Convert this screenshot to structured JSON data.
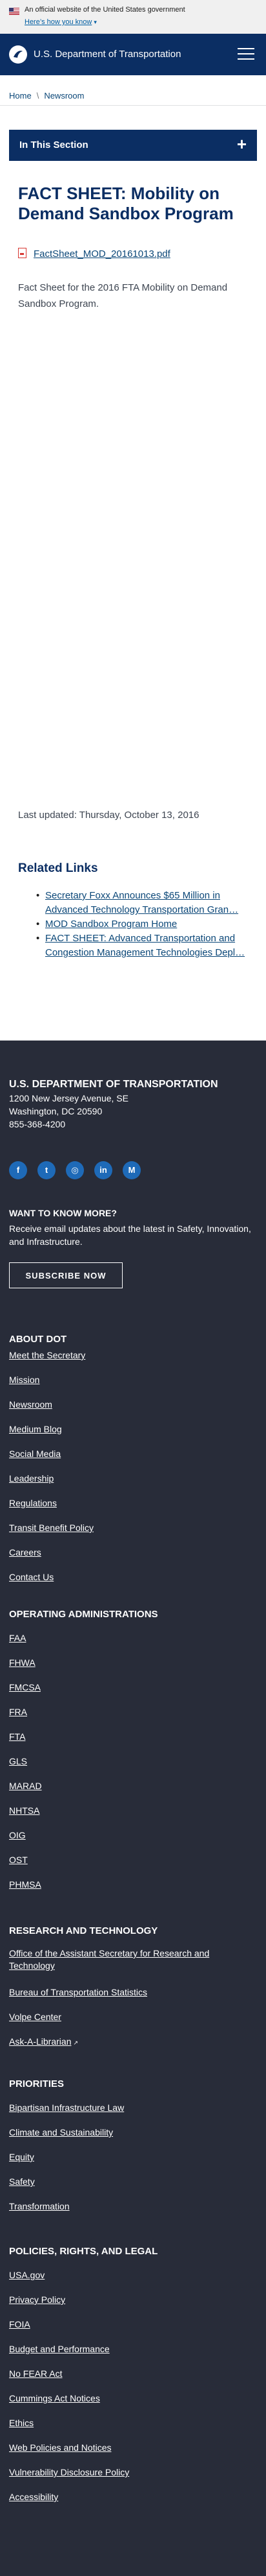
{
  "banner": {
    "official_text": "An official website of the United States government",
    "how_link": "Here’s how you know"
  },
  "header": {
    "title": "U.S. Department of Transportation",
    "menu_icon": "hamburger-menu-icon"
  },
  "breadcrumb": {
    "items": [
      "Home",
      "Newsroom"
    ],
    "separator": "\\"
  },
  "section_nav": {
    "label": "In This Section",
    "toggle": "+"
  },
  "main": {
    "title": "FACT SHEET: Mobility on Demand Sandbox Program",
    "attachment": {
      "icon": "pdf-icon",
      "label": "FactSheet_MOD_20161013.pdf"
    },
    "description": "Fact Sheet for the 2016 FTA Mobility on Demand Sandbox Program.",
    "last_updated": "Last updated: Thursday, October 13, 2016"
  },
  "related": {
    "title": "Related Links",
    "items": [
      "Secretary Foxx Announces $65 Million in Advanced Technology Transportation Gran…",
      "MOD Sandbox Program Home",
      "FACT SHEET: Advanced Transportation and Congestion Management Technologies Depl…"
    ]
  },
  "footer": {
    "agency": "U.S. DEPARTMENT OF TRANSPORTATION",
    "address": [
      "1200 New Jersey Avenue, SE",
      "Washington, DC 20590",
      "855-368-4200"
    ],
    "social": [
      {
        "icon": "facebook-icon",
        "glyph": "f"
      },
      {
        "icon": "twitter-icon",
        "glyph": "t"
      },
      {
        "icon": "instagram-icon",
        "glyph": "◎"
      },
      {
        "icon": "linkedin-icon",
        "glyph": "in"
      },
      {
        "icon": "medium-icon",
        "glyph": "M"
      }
    ],
    "want_to_know_title": "WANT TO KNOW MORE?",
    "want_to_know_desc": "Receive email updates about the latest in Safety, Innovation, and Infrastructure.",
    "subscribe_label": "SUBSCRIBE NOW",
    "sections": [
      {
        "title": "ABOUT DOT",
        "links": [
          "Meet the Secretary",
          "Mission",
          "Newsroom",
          "Medium Blog",
          "Social Media",
          "Leadership",
          "Regulations",
          "Transit Benefit Policy",
          "Careers",
          "Contact Us"
        ]
      },
      {
        "title": "OPERATING ADMINISTRATIONS",
        "links": [
          "FAA",
          "FHWA",
          "FMCSA",
          "FRA",
          "FTA",
          "GLS",
          "MARAD",
          "NHTSA",
          "OIG",
          "OST",
          "PHMSA"
        ]
      },
      {
        "title": "RESEARCH AND TECHNOLOGY",
        "links": [
          "Office of the Assistant Secretary for Research and Technology",
          "Bureau of Transportation Statistics",
          "Volpe Center",
          "Ask-A-Librarian"
        ]
      },
      {
        "title": "PRIORITIES",
        "links": [
          "Bipartisan Infrastructure Law",
          "Climate and Sustainability",
          "Equity",
          "Safety",
          "Transformation"
        ]
      },
      {
        "title": "POLICIES, RIGHTS, AND LEGAL",
        "links": [
          "USA.gov",
          "Privacy Policy",
          "FOIA",
          "Budget and Performance",
          "No FEAR Act",
          "Cummings Act Notices",
          "Ethics",
          "Web Policies and Notices",
          "Vulnerability Disclosure Policy",
          "Accessibility"
        ]
      }
    ]
  }
}
